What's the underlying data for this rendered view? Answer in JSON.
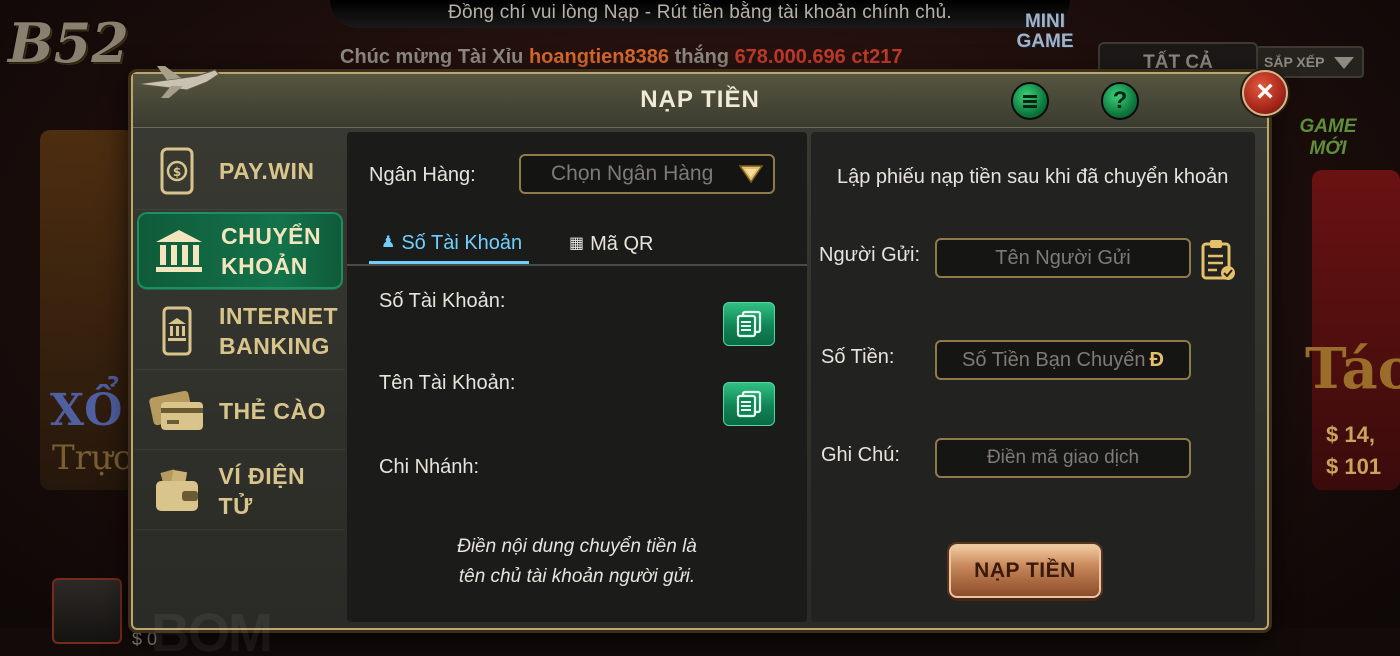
{
  "background": {
    "notice": "Đồng chí vui lòng Nạp - Rút tiền bằng tài khoản chính chủ.",
    "marquee_prefix": "Chúc mừng Tài Xỉu",
    "marquee_user": "hoangtien8386",
    "marquee_mid": "thắng",
    "marquee_amount": "678.000.696",
    "marquee_user2": "ct217",
    "logo": "B52",
    "mini_game": "MINI GAME",
    "filter": "TẤT CẢ",
    "sort": "SẮP XẾP",
    "game_new": "GAME MỚI",
    "xo": "XỔ",
    "truc": "Trực",
    "tao": "Táo",
    "money_a": "$ 14,",
    "money_b": "$ 101",
    "balance": "$ 0"
  },
  "modal": {
    "title": "NẠP TIỀN",
    "close": "×",
    "help": "?"
  },
  "sidebar": {
    "items": [
      {
        "label": "PAY.WIN"
      },
      {
        "label": "CHUYỂN KHOẢN"
      },
      {
        "label": "INTERNET BANKING"
      },
      {
        "label": "THẺ CÀO"
      },
      {
        "label": "VÍ ĐIỆN TỬ"
      }
    ],
    "watermark": "BOM"
  },
  "middle": {
    "bank_label": "Ngân Hàng:",
    "bank_placeholder": "Chọn Ngân Hàng",
    "tabs": [
      {
        "label": "Số Tài Khoản"
      },
      {
        "label": "Mã QR"
      }
    ],
    "account_number_label": "Số Tài Khoản:",
    "account_name_label": "Tên Tài Khoản:",
    "branch_label": "Chi Nhánh:",
    "note_line1": "Điền nội dung chuyển tiền là",
    "note_line2": "tên chủ tài khoản người gửi."
  },
  "right": {
    "title": "Lập phiếu nạp tiền sau khi đã chuyển khoản",
    "sender_label": "Người Gửi:",
    "sender_placeholder": "Tên Người Gửi",
    "amount_label": "Số Tiền:",
    "amount_placeholder": "Số Tiền Bạn Chuyển",
    "currency_symbol": "Đ",
    "note_label": "Ghi Chú:",
    "note_placeholder": "Điền mã giao dịch",
    "submit": "NẠP TIỀN"
  },
  "colors": {
    "accent_green": "#14734a",
    "gold": "#d9c58c",
    "tab_active": "#6fd0ff",
    "close_red": "#a7261a"
  }
}
